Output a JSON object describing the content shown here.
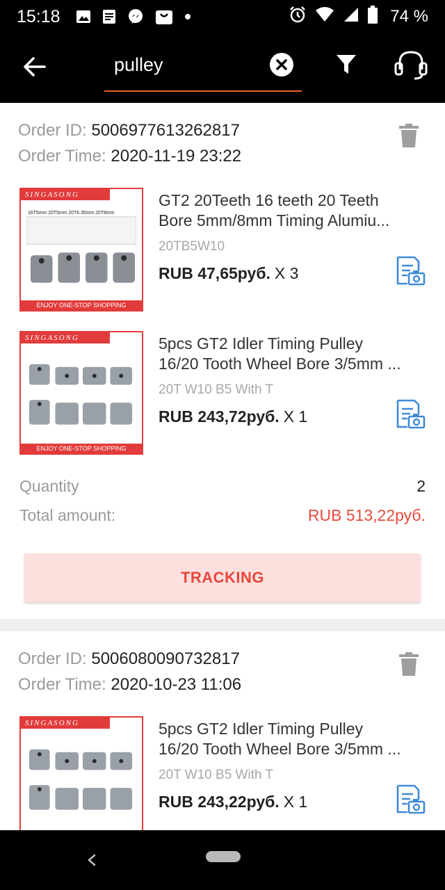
{
  "status_bar": {
    "time": "15:18",
    "battery_percent": "74 %",
    "icons": [
      "image-icon",
      "document-icon",
      "messenger-icon",
      "shopping-bag-icon",
      "dot-icon",
      "alarm-icon",
      "wifi-icon",
      "signal-icon",
      "battery-icon"
    ]
  },
  "toolbar": {
    "search_query": "pulley",
    "accent_color": "#e8632b",
    "icons": [
      "back-arrow-icon",
      "clear-icon",
      "filter-icon",
      "customer-service-icon"
    ]
  },
  "orders": [
    {
      "id_label": "Order ID:",
      "id": "5006977613262817",
      "time_label": "Order Time:",
      "time": "2020-11-19 23:22",
      "items": [
        {
          "brand": "SINGASONG",
          "banner": "ENJOY ONE-STOP SHOPPING",
          "title_line1": "GT2 20Teeth 16 teeth 20 Teeth",
          "title_line2": "Bore 5mm/8mm Timing Alumiu...",
          "sku": "20TB5W10",
          "price": "RUB 47,65руб.",
          "qty": "X 3"
        },
        {
          "brand": "SINGASONG",
          "banner": "ENJOY ONE-STOP SHOPPING",
          "title_line1": "5pcs GT2 Idler Timing Pulley",
          "title_line2": "16/20 Tooth Wheel Bore 3/5mm ...",
          "sku": "20T W10 B5 With T",
          "price": "RUB 243,72руб.",
          "qty": "X 1"
        }
      ],
      "quantity_label": "Quantity",
      "quantity": "2",
      "total_label": "Total amount:",
      "total": "RUB 513,22руб.",
      "tracking_label": "TRACKING"
    },
    {
      "id_label": "Order ID:",
      "id": "5006080090732817",
      "time_label": "Order Time:",
      "time": "2020-10-23 11:06",
      "items": [
        {
          "brand": "SINGASONG",
          "title_line1": "5pcs GT2 Idler Timing Pulley",
          "title_line2": "16/20 Tooth Wheel Bore 3/5mm ...",
          "sku": "20T W10 B5 With T",
          "price": "RUB 243,22руб.",
          "qty": "X 1"
        }
      ]
    }
  ],
  "colors": {
    "price_red": "#ea4a3c",
    "tracking_bg": "#fde0de",
    "review_icon_blue": "#3f8ad6"
  }
}
